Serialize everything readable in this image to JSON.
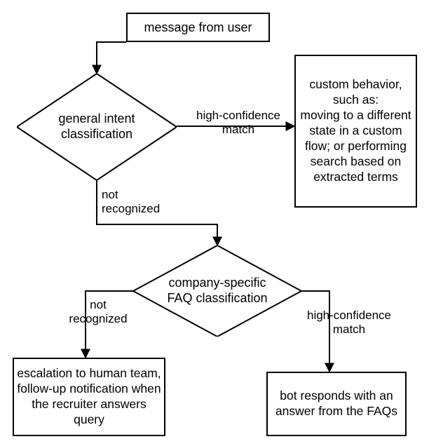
{
  "chart_data": {
    "type": "flowchart",
    "nodes": [
      {
        "id": "start",
        "shape": "rect",
        "label": "message from user"
      },
      {
        "id": "intent",
        "shape": "diamond",
        "label": "general intent classification"
      },
      {
        "id": "custom",
        "shape": "rect",
        "label": "custom behavior, such as: moving to a different state in a custom flow; or performing search based on extracted terms"
      },
      {
        "id": "faq",
        "shape": "diamond",
        "label": "company-specific FAQ classification"
      },
      {
        "id": "escal",
        "shape": "rect",
        "label": "escalation to human team, follow-up notification when the recruiter answers query"
      },
      {
        "id": "faqans",
        "shape": "rect",
        "label": "bot responds with an answer from the FAQs"
      }
    ],
    "edges": [
      {
        "from": "start",
        "to": "intent",
        "label": ""
      },
      {
        "from": "intent",
        "to": "custom",
        "label": "high-confidence match"
      },
      {
        "from": "intent",
        "to": "faq",
        "label": "not recognized"
      },
      {
        "from": "faq",
        "to": "faqans",
        "label": "high-confidence match"
      },
      {
        "from": "faq",
        "to": "escal",
        "label": "not recognized"
      }
    ]
  },
  "nodes": {
    "start": "message from user",
    "intent": "general intent classification",
    "custom": "custom behavior, such as:\nmoving to a different state in a custom flow; or performing search based on extracted terms",
    "faq": "company-specific FAQ classification",
    "escal": "escalation to human team, follow-up notification when the recruiter answers query",
    "faqans": "bot responds with an answer from the FAQs"
  },
  "edges": {
    "intent_custom": "high-confidence\nmatch",
    "intent_faq": "not\nrecognized",
    "faq_faqans": "high-confidence\nmatch",
    "faq_escal": "not\nrecognized"
  }
}
